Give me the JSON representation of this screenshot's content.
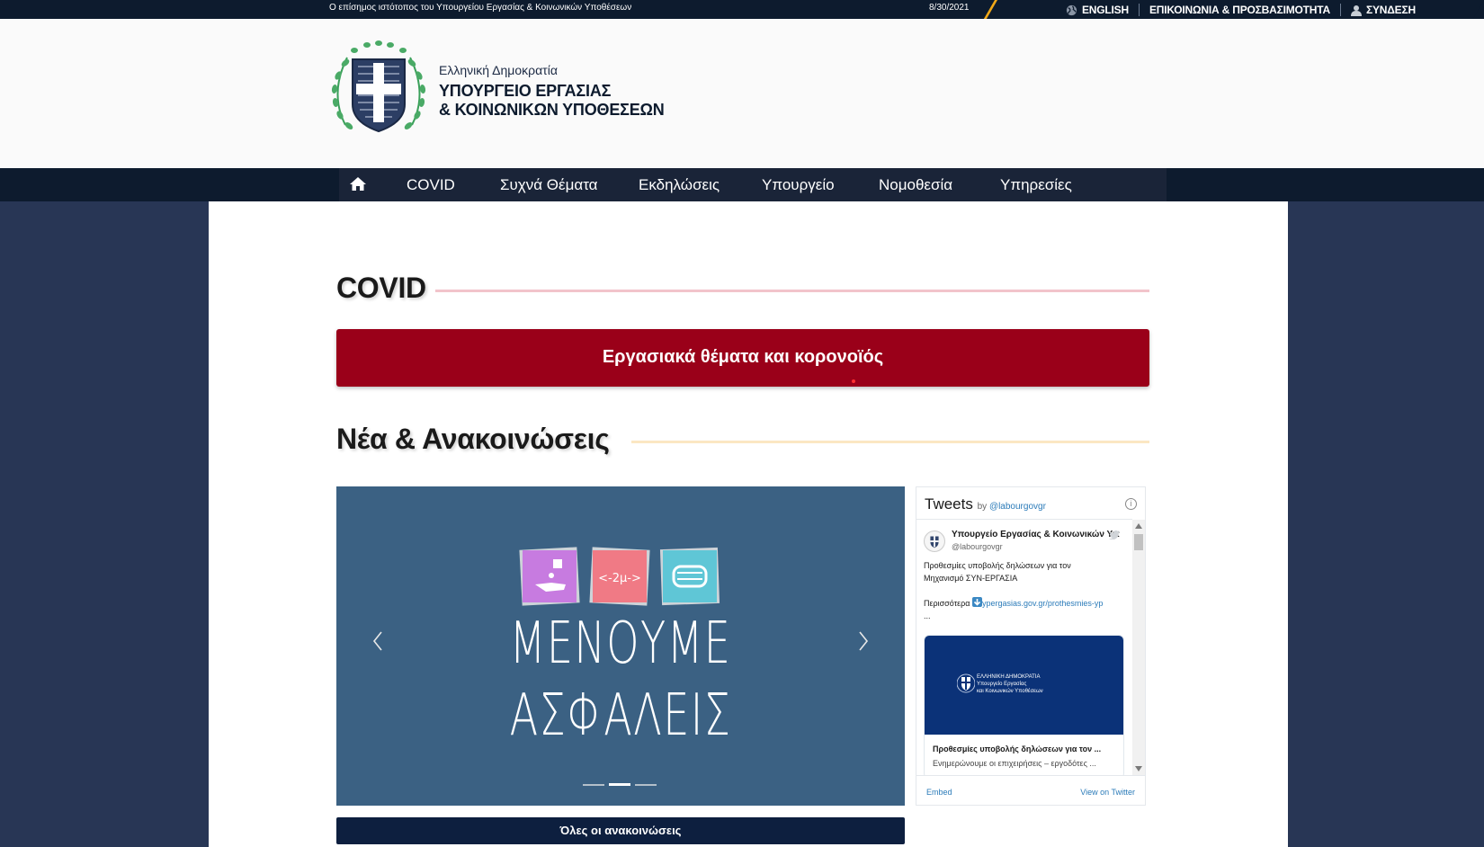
{
  "topbar": {
    "official_text": "Ο επίσημος ιστότοπος του Υπουργείου Εργασίας & Κοινωνικών Υποθέσεων",
    "date": "8/30/2021",
    "english": "ENGLISH",
    "contact": "ΕΠΙΚΟΙΝΩΝΙΑ & ΠΡΟΣΒΑΣΙΜΟΤΗΤΑ",
    "login": "ΣΥΝΔΕΣΗ"
  },
  "header": {
    "line1": "Ελληνική Δημοκρατία",
    "line2": "ΥΠΟΥΡΓΕΙΟ ΕΡΓΑΣΙΑΣ",
    "line3": "& ΚΟΙΝΩΝΙΚΩΝ ΥΠΟΘΕΣΕΩΝ"
  },
  "nav": {
    "items": [
      "COVID",
      "Συχνά Θέματα",
      "Εκδηλώσεις",
      "Υπουργείο",
      "Νομοθεσία",
      "Υπηρεσίες"
    ]
  },
  "covid": {
    "title": "COVID",
    "banner": "Εργασιακά θέματα και κορονοϊός"
  },
  "news": {
    "title": "Νέα & Ανακοινώσεις",
    "slide_line1": "ΜΕΝΟΥΜΕ",
    "slide_line2": "ΑΣΦΑΛΕΙΣ",
    "slide_badge": "<-2μ->",
    "all_button": "Όλες οι ανακοινώσεις"
  },
  "twitter": {
    "title": "Tweets",
    "by": "by ",
    "by_handle": "@labourgovgr",
    "user_name": "Υπουργείο Εργασίας & Κοινωνικών Υπ",
    "user_handle": "@labourgovgr",
    "tweet_line1": "Προθεσμίες υποβολής δηλώσεων για τον",
    "tweet_line2": "Μηχανισμό ΣΥΝ-ΕΡΓΑΣΙΑ",
    "tweet_more": "Περισσότερα ",
    "tweet_link": "ypergasias.gov.gr/prothesmies-yp",
    "tweet_ellipsis": "...",
    "card_img_l1": "ΕΛΛΗΝΙΚΗ ΔΗΜΟΚΡΑΤΙΑ",
    "card_img_l2": "Υπουργείο Εργασίας",
    "card_img_l3": "και Κοινωνικών Υποθέσεων",
    "card_title": "Προθεσμίες υποβολής δηλώσεων για τον ...",
    "card_desc": "Ενημερώνουμε οι επιχειρήσεις – εργοδότες ...",
    "embed": "Embed",
    "view": "View on Twitter"
  },
  "colors": {
    "navy": "#0d1b2e",
    "accent_gold": "#f0a818",
    "covid_red": "#9a0019",
    "slide_blue": "#3b6183",
    "page_bg": "#283655"
  }
}
